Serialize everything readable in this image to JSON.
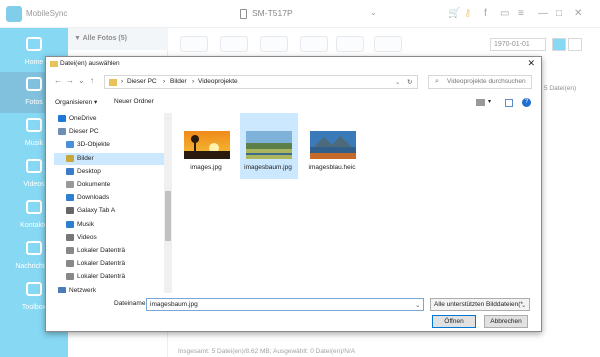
{
  "app": {
    "name": "MobileSync",
    "device": "SM-T517P"
  },
  "sidebar": {
    "items": [
      {
        "label": "Home",
        "icon": "home-icon"
      },
      {
        "label": "Fotos",
        "icon": "photo-icon"
      },
      {
        "label": "Musik",
        "icon": "music-icon"
      },
      {
        "label": "Videos",
        "icon": "video-icon"
      },
      {
        "label": "Kontakte",
        "icon": "contacts-icon"
      },
      {
        "label": "Nachrichten",
        "icon": "messages-icon"
      },
      {
        "label": "Toolbox",
        "icon": "toolbox-icon"
      }
    ]
  },
  "albums": {
    "header": "▼ Alle Fotos (5)"
  },
  "main": {
    "date": "1970-01-01",
    "count": "5 Datei(en)",
    "status": "Insgesamt: 5 Datei(en)/8.62 MB; Ausgewählt: 0 Datei(en)/N/A"
  },
  "dialog": {
    "title": "Datei(en) auswählen",
    "path": [
      "Dieser PC",
      "Bilder",
      "Videoprojekte"
    ],
    "search_placeholder": "Videoprojekte durchsuchen",
    "organize": "Organisieren ▾",
    "new_folder": "Neuer Ordner",
    "tree": [
      {
        "label": "OneDrive",
        "color": "#1f7ad6",
        "indent": 0
      },
      {
        "label": "Dieser PC",
        "color": "#6d8fb3",
        "indent": 0
      },
      {
        "label": "3D-Objekte",
        "color": "#4a90d9",
        "indent": 1
      },
      {
        "label": "Bilder",
        "color": "#c9a73b",
        "indent": 1
      },
      {
        "label": "Desktop",
        "color": "#3a7cc9",
        "indent": 1
      },
      {
        "label": "Dokumente",
        "color": "#999",
        "indent": 1
      },
      {
        "label": "Downloads",
        "color": "#2f7fd1",
        "indent": 1
      },
      {
        "label": "Galaxy Tab A",
        "color": "#666",
        "indent": 1
      },
      {
        "label": "Musik",
        "color": "#2f7fd1",
        "indent": 1
      },
      {
        "label": "Videos",
        "color": "#777",
        "indent": 1
      },
      {
        "label": "Lokaler Datenträ",
        "color": "#888",
        "indent": 1
      },
      {
        "label": "Lokaler Datenträ",
        "color": "#888",
        "indent": 1
      },
      {
        "label": "Lokaler Datenträ",
        "color": "#888",
        "indent": 1
      },
      {
        "label": "Netzwerk",
        "color": "#4a7db8",
        "indent": 0
      }
    ],
    "files": [
      {
        "name": "images.jpg",
        "thumb": "sunset",
        "selected": false
      },
      {
        "name": "imagesbaum.jpg",
        "thumb": "landscape",
        "selected": true
      },
      {
        "name": "imagesblau.heic",
        "thumb": "mountain",
        "selected": false
      }
    ],
    "filename_label": "Dateiname:",
    "filename_value": "imagesbaum.jpg",
    "filetype": "Alle unterstützten Bilddateien(*",
    "open": "Öffnen",
    "cancel": "Abbrechen"
  }
}
